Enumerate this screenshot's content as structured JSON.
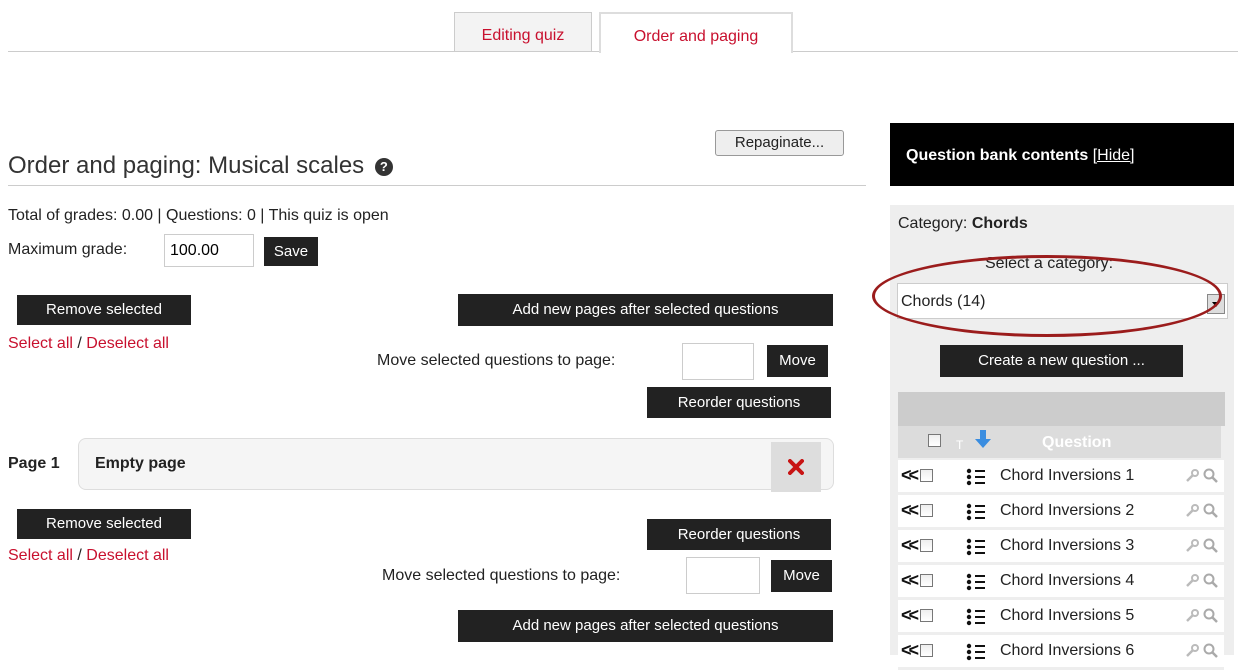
{
  "tabs": [
    {
      "label": "Editing quiz",
      "active": false
    },
    {
      "label": "Order and paging",
      "active": true
    }
  ],
  "repaginate_label": "Repaginate...",
  "page_title": "Order and paging: Musical scales",
  "summary": "Total of grades: 0.00 | Questions: 0 | This quiz is open",
  "max_grade": {
    "label": "Maximum grade:",
    "value": "100.00",
    "save_label": "Save"
  },
  "top_controls": {
    "remove_selected": "Remove selected",
    "select_all": "Select all",
    "separator": "/",
    "deselect_all": "Deselect all",
    "add_pages": "Add new pages after selected questions",
    "move_label": "Move selected questions to page:",
    "move_button": "Move",
    "reorder": "Reorder questions"
  },
  "page1": {
    "label": "Page 1",
    "status": "Empty page"
  },
  "bottom_controls": {
    "remove_selected": "Remove selected",
    "select_all": "Select all",
    "separator": "/",
    "deselect_all": "Deselect all",
    "reorder": "Reorder questions",
    "move_label": "Move selected questions to page:",
    "move_button": "Move",
    "add_pages": "Add new pages after selected questions"
  },
  "question_bank": {
    "title": "Question bank contents",
    "hide_label": "[Hide]",
    "category_prefix": "Category:",
    "category_name": "Chords",
    "select_category_label": "Select a category:",
    "selected_category": "Chords (14)",
    "create_button": "Create a new question ...",
    "type_col": "T",
    "question_col": "Question",
    "questions": [
      "Chord Inversions 1",
      "Chord Inversions 2",
      "Chord Inversions 3",
      "Chord Inversions 4",
      "Chord Inversions 5",
      "Chord Inversions 6"
    ]
  },
  "colors": {
    "link": "#c8102e",
    "dark_button": "#222222",
    "annotation_ellipse": "#9b1c1c",
    "sort_arrow": "#3a8de0"
  }
}
